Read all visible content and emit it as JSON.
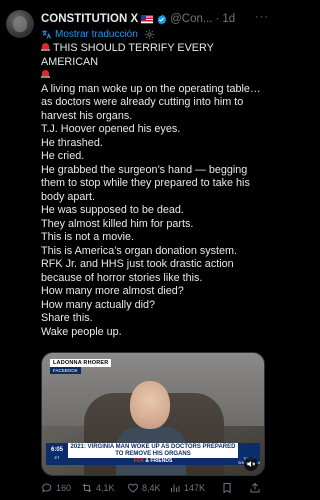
{
  "post": {
    "author_name": "CONSTITUTION X",
    "handle": "@Con...",
    "time": "1d",
    "more_label": "···",
    "translate_label": "Mostrar traducción",
    "lines": [
      "THIS SHOULD TERRIFY EVERY AMERICAN",
      "A living man woke up on the operating table… as doctors were already cutting into him to harvest his organs.",
      "T.J. Hoover opened his eyes.",
      "He thrashed.",
      "He cried.",
      "He grabbed the surgeon’s hand — begging them to stop while they prepared to take his body apart.",
      "He was supposed to be dead.",
      "They almost killed him for parts.",
      "This is not a movie.",
      "This is America’s organ donation system.",
      "RFK Jr. and HHS just took drastic action because of horror stories like this.",
      "How many more almost died?",
      "How many actually did?",
      "Share this.",
      "Wake people up."
    ]
  },
  "media": {
    "chyron_name": "LADONNA RHORER",
    "chyron_source": "FACEBOOK",
    "clock": "6:05",
    "clock_sub": "ET",
    "headline": "2021: VIRGINIA MAN WOKE UP AS DOCTORS PREPARED TO REMOVE HIS ORGANS",
    "network_prefix": "FOX",
    "network_suffix": "& FRIENDS",
    "sidebox_label": "TODAY SHOWROOM"
  },
  "actions": {
    "replies": "160",
    "reposts": "4,1K",
    "likes": "8,4K",
    "views": "147K"
  },
  "colors": {
    "accent": "#1d9bf0",
    "muted": "#71767b",
    "background": "#000000",
    "siren": "#e3262d"
  }
}
